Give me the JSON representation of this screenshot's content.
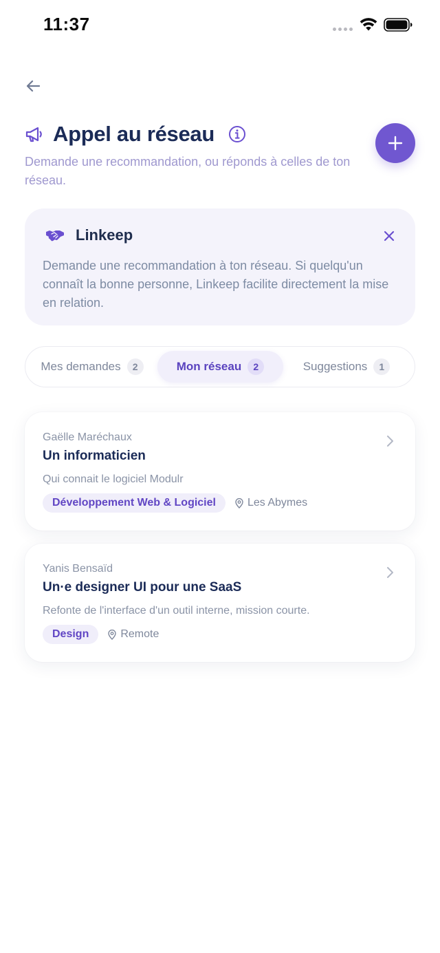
{
  "status_bar": {
    "time": "11:37"
  },
  "header": {
    "title": "Appel au réseau",
    "subtitle": "Demande une recommandation, ou réponds à celles de ton réseau."
  },
  "info_card": {
    "title": "Linkeep",
    "text": "Demande une recommandation à ton réseau. Si quelqu'un connaît la bonne personne, Linkeep facilite directement la mise en relation."
  },
  "tabs": [
    {
      "label": "Mes demandes",
      "count": "2",
      "selected": false
    },
    {
      "label": "Mon réseau",
      "count": "2",
      "selected": true
    },
    {
      "label": "Suggestions",
      "count": "1",
      "selected": false
    }
  ],
  "requests": [
    {
      "author": "Gaëlle Maréchaux",
      "title": "Un informaticien",
      "description": "Qui connait le logiciel Modulr",
      "tag": "Développement Web & Logiciel",
      "location": "Les Abymes"
    },
    {
      "author": "Yanis Bensaïd",
      "title": "Un·e designer UI pour une SaaS",
      "description": "Refonte de l'interface d'un outil interne, mission courte.",
      "tag": "Design",
      "location": "Remote"
    }
  ],
  "colors": {
    "accent": "#7057d0",
    "title": "#1b2b57",
    "subtitle": "#9f98cf",
    "card_bg": "#f4f3fb"
  },
  "icons": {
    "back": "arrow-left-icon",
    "header": "megaphone-icon",
    "info": "info-icon",
    "add": "plus-icon",
    "brand": "handshake-icon",
    "close": "close-icon",
    "location": "map-pin-icon",
    "open": "chevron-right-icon"
  }
}
